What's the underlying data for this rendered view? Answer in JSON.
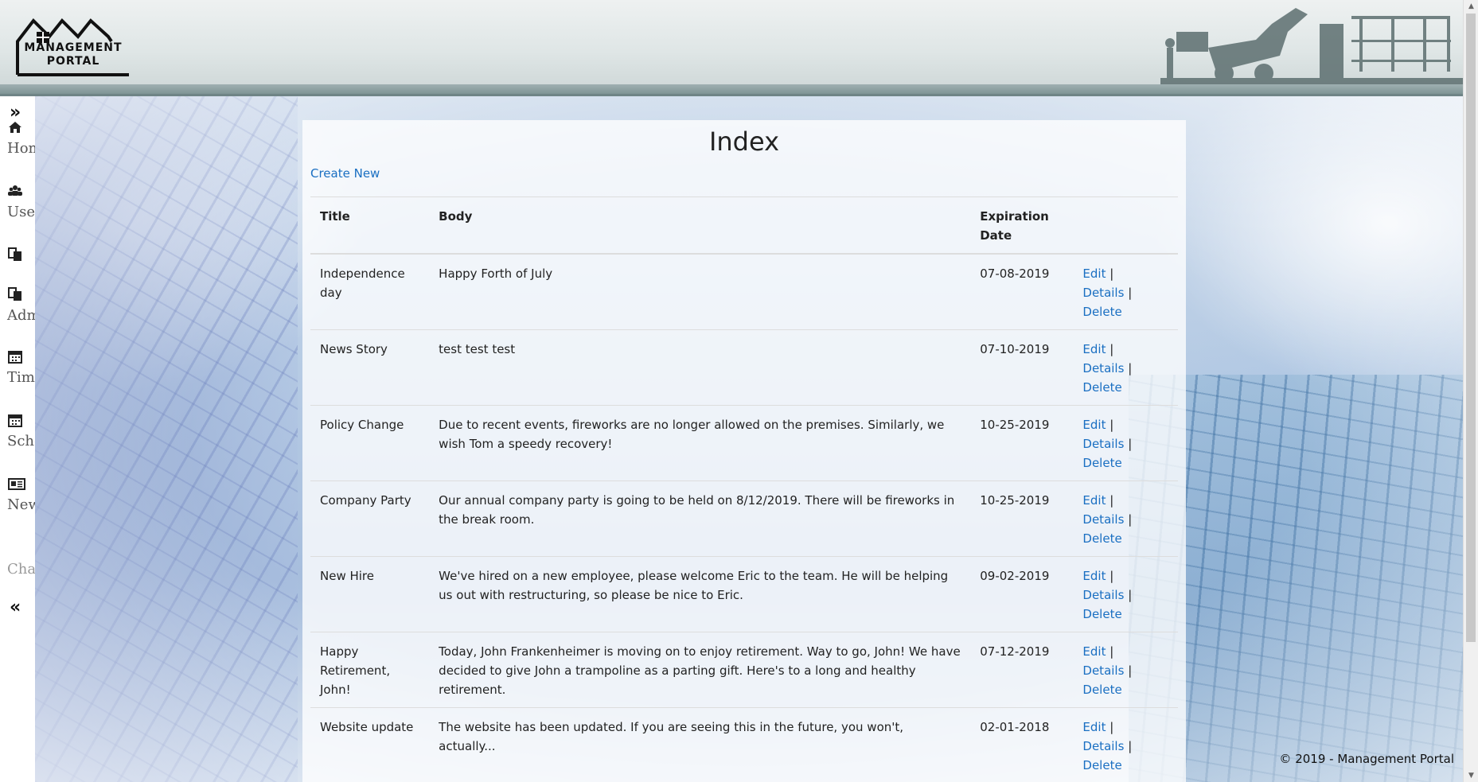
{
  "header": {
    "logo_line1": "MANAGEMENT",
    "logo_line2": "PORTAL"
  },
  "sidebar": {
    "expand_icon": "double-chevron-right-icon",
    "collapse_icon": "double-chevron-left-icon",
    "items": [
      {
        "label": "Hom",
        "icon": "home-icon"
      },
      {
        "label": "User",
        "icon": "users-icon"
      },
      {
        "label": "",
        "icon": "copy-icon"
      },
      {
        "label": "Adm",
        "icon": "copy-icon"
      },
      {
        "label": "Time",
        "icon": "calendar-icon"
      },
      {
        "label": "Sche",
        "icon": "calendar-icon"
      },
      {
        "label": "New",
        "icon": "newspaper-icon"
      },
      {
        "label": "Chat",
        "icon": ""
      }
    ]
  },
  "main": {
    "title": "Index",
    "create_new": "Create New",
    "columns": [
      "Title",
      "Body",
      "Expiration Date",
      ""
    ],
    "actions": {
      "edit": "Edit",
      "details": "Details",
      "delete": "Delete",
      "separator": "|"
    },
    "rows": [
      {
        "title": "Independence day",
        "body": "Happy Forth of July",
        "date": "07-08-2019"
      },
      {
        "title": "News Story",
        "body": "test test test",
        "date": "07-10-2019"
      },
      {
        "title": "Policy Change",
        "body": "Due to recent events, fireworks are no longer allowed on the premises. Similarly, we wish Tom a speedy recovery!",
        "date": "10-25-2019"
      },
      {
        "title": "Company Party",
        "body": "Our annual company party is going to be held on 8/12/2019. There will be fireworks in the break room.",
        "date": "10-25-2019"
      },
      {
        "title": "New Hire",
        "body": "We've hired on a new employee, please welcome Eric to the team. He will be helping us out with restructuring, so please be nice to Eric.",
        "date": "09-02-2019"
      },
      {
        "title": "Happy Retirement, John!",
        "body": "Today, John Frankenheimer is moving on to enjoy retirement. Way to go, John! We have decided to give John a trampoline as a parting gift. Here's to a long and healthy retirement.",
        "date": "07-12-2019"
      },
      {
        "title": "Website update",
        "body": "The website has been updated. If you are seeing this in the future, you won't, actually...",
        "date": "02-01-2018"
      }
    ]
  },
  "footer": {
    "text": "© 2019 - Management Portal"
  }
}
